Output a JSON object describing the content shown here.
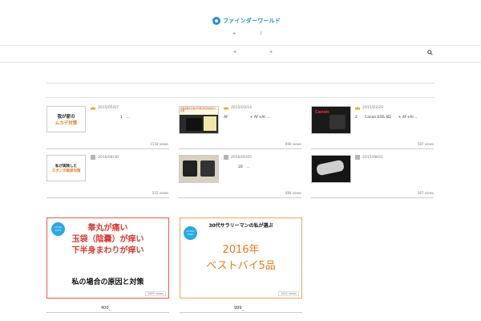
{
  "header": {
    "logo_text": "ファインダーワールド",
    "sub_nav": [
      "+",
      "♪"
    ],
    "main_nav": [
      "+",
      "+"
    ]
  },
  "colors": {
    "brand": "#1d8fd8",
    "crown": "#e8a51d",
    "accent_red": "#d63b2f",
    "accent_orange": "#e87c1e",
    "date_circle": "#2aa9e0"
  },
  "cards": [
    {
      "thumb_text": [
        "我が家の",
        "ムカデ対策"
      ],
      "date": "2015/05/07",
      "title": "1　…",
      "views": "1118 views",
      "badge": "crown"
    },
    {
      "thumb_text": [
        "新製品格安比較AF性能比較比較検討の結果"
      ],
      "date": "2015/03/14",
      "title": "AF　　　　　　+ AF+AI …",
      "views": "990 views",
      "badge": "crown"
    },
    {
      "thumb_text": [
        "Canon"
      ],
      "date": "2015/03/29",
      "title": "2　　Canon EOS 6D　　+ AF+AI…",
      "views": "587 views",
      "badge": "crown"
    },
    {
      "thumb_text": [
        "私が実践した",
        "ズボン汗蒸痒対策"
      ],
      "date": "2016/04/30",
      "title": "",
      "views": "515 views",
      "badge": "5"
    },
    {
      "thumb_text": [],
      "date": "2016/05/05",
      "title": "20　…",
      "views": "484 views",
      "badge": "5"
    },
    {
      "thumb_text": [],
      "date": "2015/08/01",
      "title": "",
      "views": "367 views",
      "badge": "6"
    }
  ],
  "banners": [
    {
      "date_circle": [
        "15 Jan",
        "2017"
      ],
      "lines": [
        "睾丸が痛い",
        "玉袋（陰嚢）が痒い",
        "下半身まわりが痒い"
      ],
      "subline": "私の場合の原因と対策",
      "views": "3855 views",
      "caption": "400_"
    },
    {
      "date_circle": [
        "11 Dec",
        "2016"
      ],
      "topline": "30代サラリーマンの私が選ぶ",
      "lines": [
        "2016年",
        "ベストバイ5品"
      ],
      "views": "1421 views",
      "caption": "999_"
    }
  ]
}
